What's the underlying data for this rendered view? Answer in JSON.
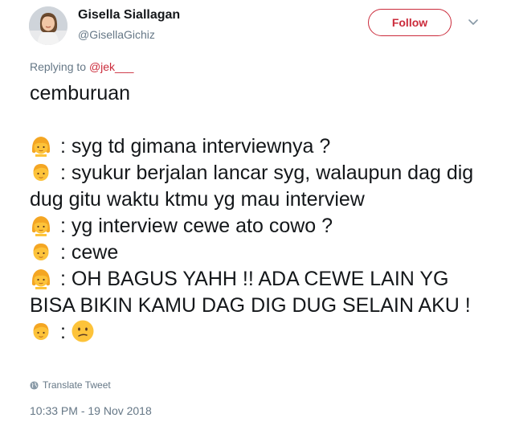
{
  "user": {
    "name": "Gisella Siallagan",
    "handle": "@GisellaGichiz",
    "avatar_icon": "profile-photo"
  },
  "follow_button": {
    "label": "Follow"
  },
  "menu": {
    "icon": "chevron-down-icon"
  },
  "reply": {
    "prefix": "Replying to",
    "mention": "@jek___"
  },
  "tweet": {
    "lines": [
      "cemburuan",
      "",
      ": syg td gimana interviewnya ?",
      ": syukur berjalan lancar syg, walaupun dag dig dug gitu waktu ktmu yg mau interview",
      ": yg interview cewe ato cowo ?",
      ": cewe",
      ": OH BAGUS YAHH !! ADA CEWE LAIN YG BISA BIKIN KAMU DAG DIG DUG SELAIN AKU !",
      ":"
    ],
    "speaker_icons": [
      "girl-emoji-icon",
      "boy-emoji-icon",
      "girl-emoji-icon",
      "boy-emoji-icon",
      "girl-emoji-icon",
      "boy-emoji-icon"
    ],
    "final_icon": "confused-face-emoji-icon"
  },
  "translate": {
    "label": "Translate Tweet",
    "icon": "globe-icon"
  },
  "timestamp": "10:33 PM - 19 Nov 2018",
  "colors": {
    "accent": "#cb2b3b",
    "secondary_text": "#657786",
    "emoji_skin": "#fdc33a"
  }
}
